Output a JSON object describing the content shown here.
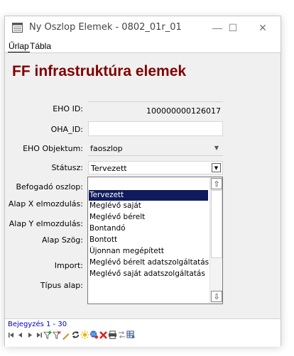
{
  "window": {
    "title": "Ny Oszlop Elemek - 0802_01r_01",
    "minimize_glyph": "—",
    "maximize_glyph": "☐",
    "close_glyph": "✕"
  },
  "tabs": [
    {
      "label": "Űrlap"
    },
    {
      "label": "Tábla"
    }
  ],
  "form": {
    "heading": "FF infrastruktúra elemek",
    "fields": {
      "eho_id": {
        "label": "EHO ID:",
        "value": "100000000126017"
      },
      "oha_id": {
        "label": "OHA_ID:",
        "value": ""
      },
      "eho_objektum": {
        "label": "EHO Objektum:",
        "value": "faoszlop"
      },
      "statusz": {
        "label": "Státusz:",
        "value": "Tervezett"
      },
      "befogado_oszlop": {
        "label": "Befogadó oszlop:"
      },
      "alap_x": {
        "label": "Alap X elmozdulás:"
      },
      "alap_y": {
        "label": "Alap Y elmozdulás:"
      },
      "alap_szog": {
        "label": "Alap Szög:"
      },
      "import": {
        "label": "Import:"
      },
      "tipus_alap": {
        "label": "Típus alap:"
      }
    }
  },
  "dropdown": {
    "options": [
      "Tervezett",
      "Meglévő saját",
      "Meglévő bérelt",
      "Bontandó",
      "Bontott",
      "Újonnan megépített",
      "Meglévő bérelt adatszolgáltatás",
      "Meglévő saját adatszolgáltatás"
    ],
    "selected": "Tervezett",
    "scroll_up_glyph": "⇧",
    "scroll_down_glyph": "⇩"
  },
  "navigation": {
    "record_label": "Bejegyzés 1 - 30",
    "buttons": [
      "first",
      "previous",
      "next",
      "last",
      "filter-add",
      "filter-remove",
      "edit",
      "refresh",
      "new",
      "zoom",
      "delete",
      "print",
      "transfer",
      "export"
    ]
  },
  "colors": {
    "heading": "#800000",
    "selection": "#0f1b5c",
    "record_label": "#0000cc"
  }
}
